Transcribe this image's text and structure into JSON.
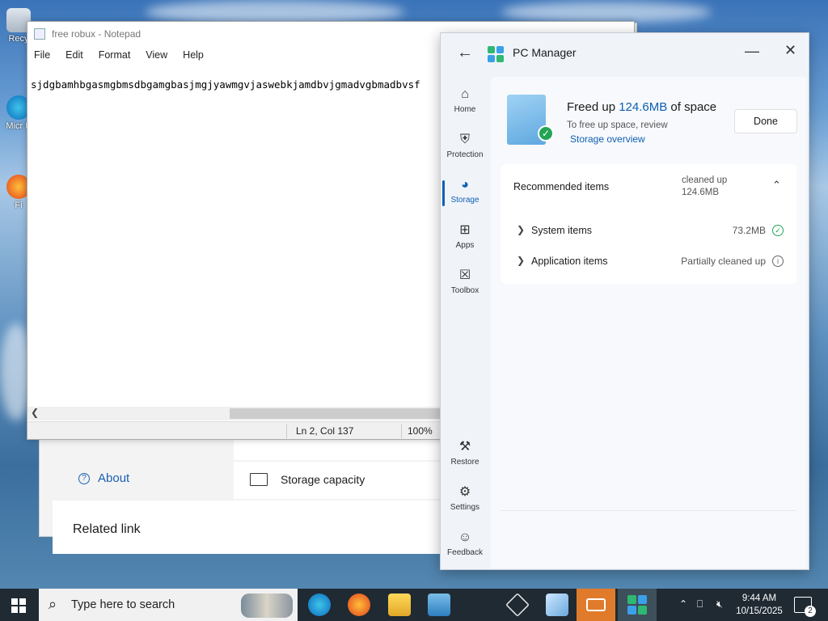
{
  "desktop": {
    "icons": [
      {
        "label": "Recy",
        "icon": "recycle-bin-icon"
      },
      {
        "label": "Micr\nE",
        "icon": "edge-icon"
      },
      {
        "label": "Fi",
        "icon": "firefox-icon"
      }
    ]
  },
  "settings_window": {
    "about_label": "About",
    "storage_capacity_label": "Storage capacity",
    "related_link_label": "Related link"
  },
  "notepad": {
    "title": "free robux - Notepad",
    "menu": [
      "File",
      "Edit",
      "Format",
      "View",
      "Help"
    ],
    "content": "sjdgbamhbgasmgbmsdbgamgbasjmgjyawmgvjaswebkjamdbvjgmadvgbmadbvsf",
    "status_position": "Ln 2, Col 137",
    "status_zoom": "100%"
  },
  "pc_manager": {
    "title": "PC Manager",
    "nav": [
      {
        "label": "Home",
        "icon": "home-icon"
      },
      {
        "label": "Protection",
        "icon": "shield-icon"
      },
      {
        "label": "Storage",
        "icon": "pie-chart-icon",
        "active": true
      },
      {
        "label": "Apps",
        "icon": "apps-grid-icon"
      },
      {
        "label": "Toolbox",
        "icon": "toolbox-icon"
      },
      {
        "label": "Restore",
        "icon": "wrench-icon"
      },
      {
        "label": "Settings",
        "icon": "gear-icon"
      },
      {
        "label": "Feedback",
        "icon": "feedback-icon"
      }
    ],
    "hero": {
      "freed_prefix": "Freed up ",
      "freed_amount": "124.6MB",
      "freed_suffix": " of space",
      "subtitle": "To free up space, review",
      "link": "Storage overview",
      "done_label": "Done"
    },
    "recommended": {
      "title": "Recommended items",
      "status_line1": "cleaned up",
      "status_line2": "124.6MB",
      "rows": [
        {
          "label": "System items",
          "value": "73.2MB",
          "badge": "check-circle-icon"
        },
        {
          "label": "Application items",
          "value": "Partially cleaned up",
          "badge": "info-circle-icon"
        }
      ]
    }
  },
  "taskbar": {
    "search_placeholder": "Type here to search",
    "time": "9:44 AM",
    "date": "10/15/2025",
    "notification_count": "2"
  },
  "colors": {
    "accent": "#0f5fb4",
    "success": "#23a455",
    "taskbar_bg": "#1f2a33"
  }
}
